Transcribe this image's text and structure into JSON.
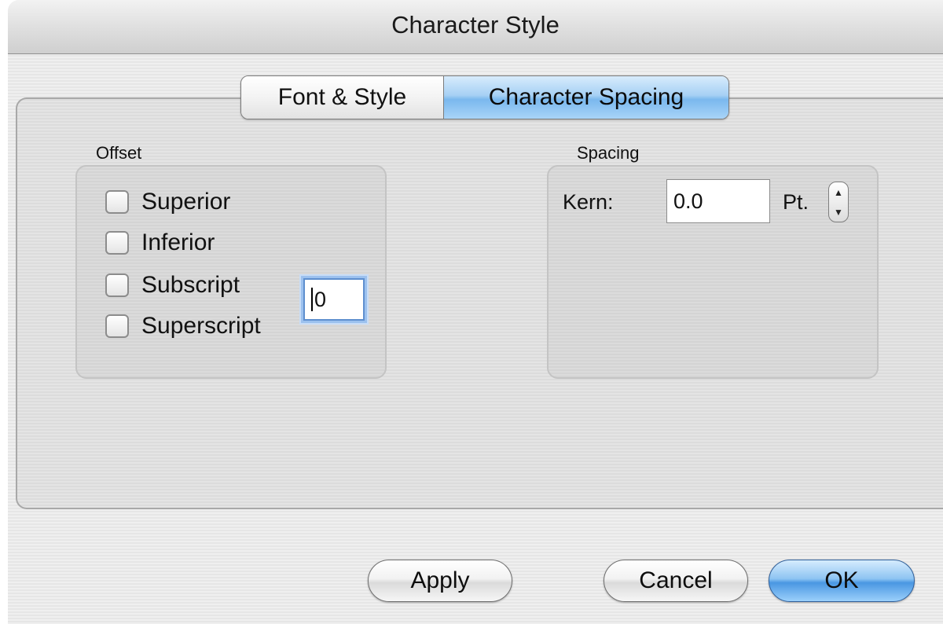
{
  "window": {
    "title": "Character Style"
  },
  "tabs": [
    {
      "label": "Font & Style",
      "selected": false
    },
    {
      "label": "Character Spacing",
      "selected": true
    }
  ],
  "offset": {
    "label": "Offset",
    "options": [
      {
        "label": "Superior",
        "checked": false
      },
      {
        "label": "Inferior",
        "checked": false
      },
      {
        "label": "Subscript",
        "checked": false
      },
      {
        "label": "Superscript",
        "checked": false
      }
    ],
    "value": "0"
  },
  "spacing": {
    "label": "Spacing",
    "kern_label": "Kern:",
    "kern_value": "0.0",
    "unit": "Pt."
  },
  "buttons": {
    "apply": "Apply",
    "cancel": "Cancel",
    "ok": "OK"
  }
}
